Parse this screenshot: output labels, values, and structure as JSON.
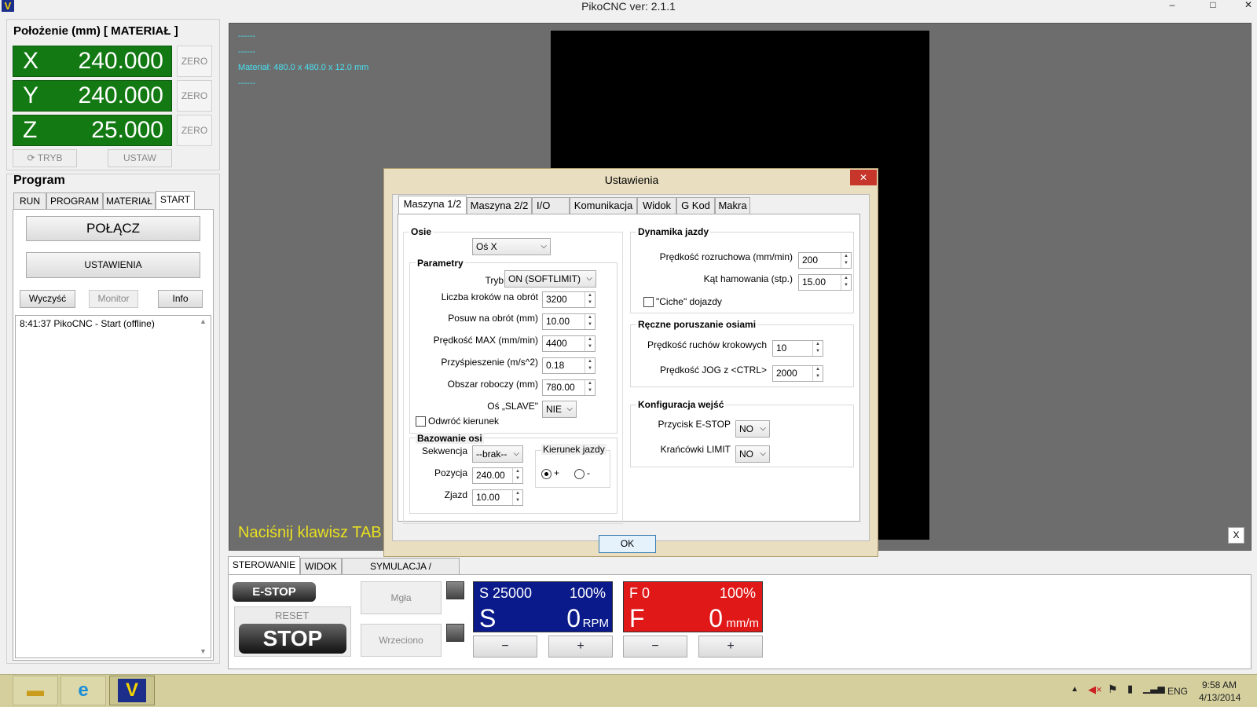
{
  "window": {
    "title": "PikoCNC ver: 2.1.1"
  },
  "position": {
    "title": "Położenie (mm) [ MATERIAŁ ]",
    "axes": [
      {
        "label": "X",
        "value": "240.000",
        "zero": "ZERO"
      },
      {
        "label": "Y",
        "value": "240.000",
        "zero": "ZERO"
      },
      {
        "label": "Z",
        "value": "25.000",
        "zero": "ZERO"
      }
    ],
    "tryb": "TRYB",
    "ustaw": "USTAW"
  },
  "program": {
    "title": "Program",
    "tabs": [
      "RUN",
      "PROGRAM",
      "MATERIAŁ",
      "START"
    ],
    "connect": "POŁĄCZ",
    "settings": "USTAWIENIA",
    "clear": "Wyczyść",
    "monitor": "Monitor",
    "info": "Info",
    "log": "8:41:37 PikoCNC - Start (offline)"
  },
  "viewport": {
    "lines": [
      "------",
      "------",
      "Materiał: 480.0 x 480.0 x 12.0 mm",
      "------"
    ],
    "hint": "Naciśnij klawisz TAB",
    "close": "X"
  },
  "control": {
    "tabs": [
      "STEROWANIE",
      "WIDOK",
      "SYMULACJA / NARZĘDZIA"
    ],
    "estop": "E-STOP",
    "reset": "RESET",
    "stop": "STOP",
    "mist": "Mgła",
    "spindle": "Wrzeciono",
    "s_panel": {
      "head": "S 25000",
      "pct": "100%",
      "letter": "S",
      "value": "0",
      "unit": "RPM",
      "minus": "−",
      "plus": "+",
      "color": "#0a1a8a"
    },
    "f_panel": {
      "head": "F 0",
      "pct": "100%",
      "letter": "F",
      "value": "0",
      "unit": "mm/m",
      "minus": "−",
      "plus": "+",
      "color": "#e01818"
    }
  },
  "dialog": {
    "title": "Ustawienia",
    "close": "✕",
    "tabs": [
      "Maszyna 1/2",
      "Maszyna 2/2",
      "I/O",
      "Komunikacja",
      "Widok",
      "G Kod",
      "Makra"
    ],
    "osie": {
      "title": "Osie",
      "axis_select": "Oś X"
    },
    "parametry": {
      "title": "Parametry",
      "tryb_label": "Tryb",
      "tryb_value": "ON (SOFTLIMIT)",
      "fields": [
        {
          "label": "Liczba kroków na obrót",
          "value": "3200"
        },
        {
          "label": "Posuw na obrót (mm)",
          "value": "10.00"
        },
        {
          "label": "Prędkość MAX (mm/min)",
          "value": "4400"
        },
        {
          "label": "Przyśpieszenie (m/s^2)",
          "value": "0.18"
        },
        {
          "label": "Obszar roboczy (mm)",
          "value": "780.00"
        }
      ],
      "slave_label": "Oś „SLAVE\"",
      "slave_value": "NIE",
      "reverse": "Odwróć kierunek"
    },
    "bazowanie": {
      "title": "Bazowanie osi",
      "seq_label": "Sekwencja",
      "seq_value": "--brak--",
      "pos_label": "Pozycja",
      "pos_value": "240.00",
      "zjazd_label": "Zjazd",
      "zjazd_value": "10.00",
      "dir_title": "Kierunek jazdy",
      "dir_plus": "+",
      "dir_minus": "-"
    },
    "dynamika": {
      "title": "Dynamika jazdy",
      "start_label": "Prędkość rozruchowa (mm/min)",
      "start_value": "200",
      "angle_label": "Kąt hamowania (stp.)",
      "angle_value": "15.00",
      "quiet": "\"Ciche\" dojazdy"
    },
    "reczne": {
      "title": "Ręczne poruszanie osiami",
      "step_label": "Prędkość ruchów krokowych",
      "step_value": "10",
      "jog_label": "Prędkość  JOG z <CTRL>",
      "jog_value": "2000"
    },
    "wejscia": {
      "title": "Konfiguracja wejść",
      "estop_label": "Przycisk E-STOP",
      "estop_value": "NO",
      "limit_label": "Krańcówki LIMIT",
      "limit_value": "NO"
    },
    "ok": "OK"
  },
  "taskbar": {
    "lang": "ENG",
    "time": "9:58 AM",
    "date": "4/13/2014"
  }
}
